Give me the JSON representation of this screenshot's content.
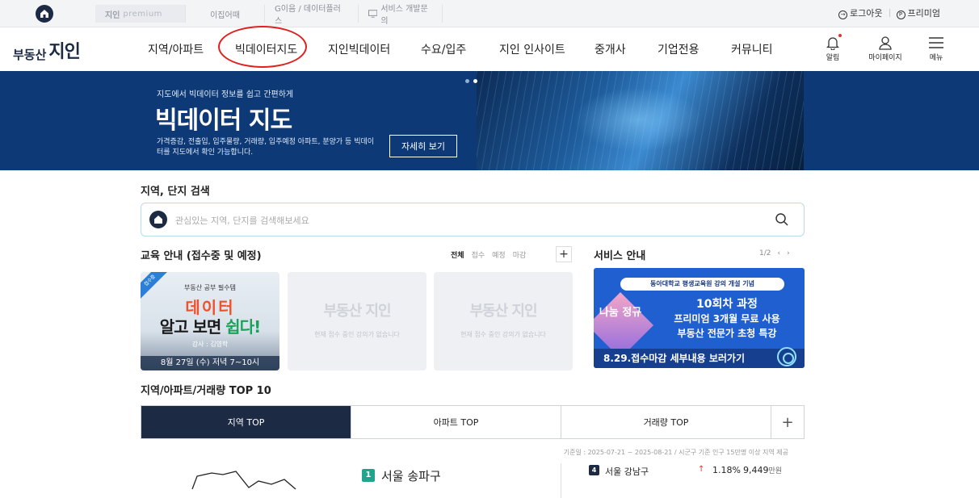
{
  "topbar": {
    "tabs": [
      {
        "brand": "지인",
        "sub": "premium"
      },
      {
        "label": "이집어때"
      },
      {
        "label": "G이음 / 데이터플러스"
      },
      {
        "label": "서비스 개발문의"
      }
    ],
    "logout": "로그아웃",
    "premium": "프리미엄"
  },
  "logo": {
    "prefix": "부동산",
    "main": "지인"
  },
  "nav": {
    "items": [
      "지역/아파트",
      "빅데이터지도",
      "지인빅데이터",
      "수요/입주",
      "지인 인사이트",
      "중개사",
      "기업전용",
      "커뮤니티"
    ],
    "icons": {
      "alarm": "알림",
      "mypage": "마이페이지",
      "menu": "메뉴"
    }
  },
  "banner": {
    "kicker": "지도에서 빅데이터 정보를 쉽고 간편하게",
    "headline": "빅데이터 지도",
    "desc": "가격증감, 전출입, 입주물량, 거래량, 입주예정 아파트, 분양가 등 빅데이터를 지도에서 확인 가능합니다.",
    "cta": "자세히 보기"
  },
  "search": {
    "title": "지역, 단지 검색",
    "placeholder": "관심있는 지역, 단지를 검색해보세요"
  },
  "education": {
    "title": "교육 안내 (접수중 및 예정)",
    "filters": [
      "전체",
      "접수",
      "예정",
      "마감"
    ],
    "promo": {
      "corner": "접수중",
      "small": "부동산 공부 필수템",
      "line1": "데이터",
      "line2a": "알고 보면 ",
      "line2b": "쉽다!",
      "lecturer": "강사 : 김영학",
      "date": "8월 27일 (수) 저녁 7~10시"
    },
    "empty_logo": "부동산 지인",
    "empty_msg": "현재 접수 중인 강의가 없습니다"
  },
  "service": {
    "title": "서비스 안내",
    "pager": "1/2",
    "pill": "동아대학교 평생교육원 강의 개설 기념",
    "badge": "나눔 정규",
    "line1": "10회차 과정",
    "line2": "프리미엄 3개월 무료 사용",
    "line3": "부동산 전문가 초청 특강",
    "bottom": "8.29.접수마감 세부내용 보러가기"
  },
  "top10": {
    "title": "지역/아파트/거래량 TOP 10",
    "tabs": [
      "지역 TOP",
      "아파트 TOP",
      "거래량 TOP"
    ],
    "basis": "기준일 : 2025-07-21 ~ 2025-08-21 / 시군구 기준 인구 15만명 이상 지역 제공",
    "rank1": {
      "rank": "1",
      "name": "서울 송파구"
    },
    "rank4": {
      "rank": "4",
      "name": "서울 강남구",
      "change": "1.18%",
      "price": "9,449",
      "unit": "만원"
    }
  }
}
